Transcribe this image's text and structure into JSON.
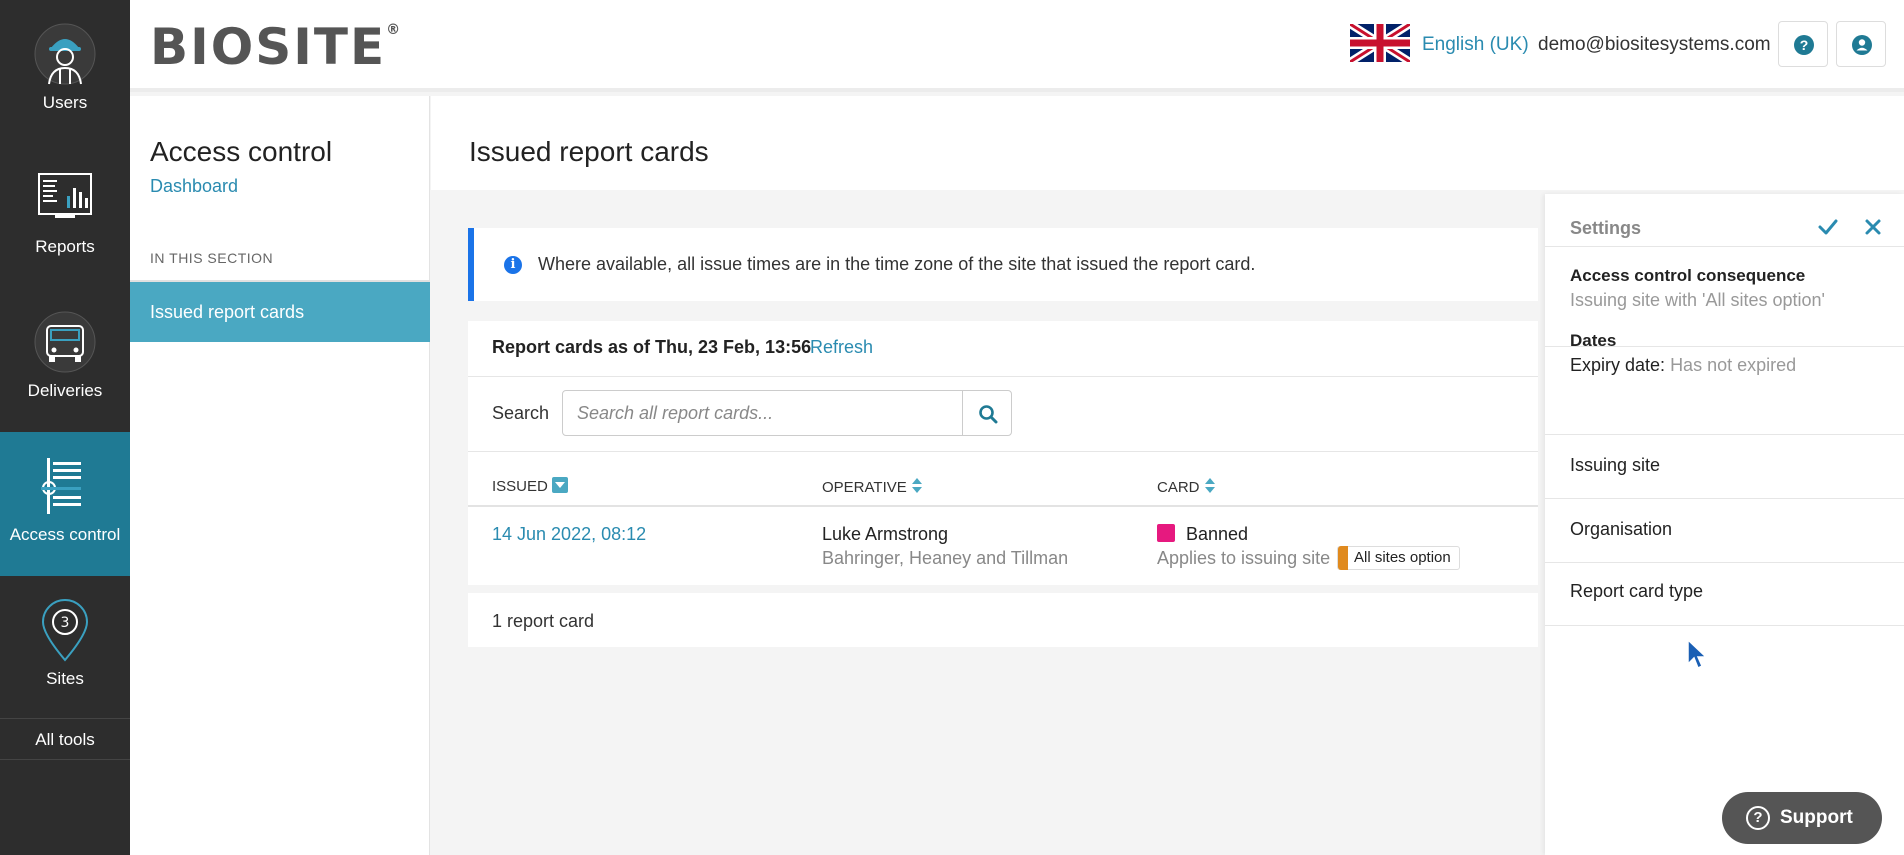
{
  "leftnav": {
    "items": [
      {
        "label": "Users",
        "icon": "worker-icon"
      },
      {
        "label": "Reports",
        "icon": "report-chart-icon"
      },
      {
        "label": "Deliveries",
        "icon": "truck-icon"
      },
      {
        "label": "Access control",
        "icon": "barrier-list-icon",
        "active": true
      },
      {
        "label": "Sites",
        "icon": "location-pin-icon"
      }
    ],
    "all_tools": "All tools"
  },
  "header": {
    "logo": "BIOSITE",
    "logo_mark": "®",
    "language": "English (UK)",
    "email": "demo@biositesystems.com",
    "help_icon": "help-icon",
    "user_icon": "user-icon",
    "help_glyph": "?",
    "user_glyph": "●"
  },
  "section": {
    "title": "Access control",
    "link": "Dashboard",
    "subheading": "IN THIS SECTION",
    "active_item": "Issued report cards"
  },
  "main": {
    "title": "Issued report cards",
    "info_glyph": "i",
    "info_text": "Where available, all issue times are in the time zone of the site that issued the report card.",
    "as_of": "Report cards as of Thu, 23 Feb, 13:56",
    "refresh": "Refresh",
    "search_label": "Search",
    "search_placeholder": "Search all report cards...",
    "columns": {
      "issued": "ISSUED",
      "operative": "OPERATIVE",
      "card": "CARD"
    },
    "rows": [
      {
        "issued": "14 Jun 2022, 08:12",
        "operative_name": "Luke Armstrong",
        "operative_org": "Bahringer, Heaney and Tillman",
        "card_name": "Banned",
        "card_color": "#e6197f",
        "card_scope": "Applies to issuing site",
        "badge": "All sites option"
      }
    ],
    "count": "1 report card"
  },
  "settings": {
    "title": "Settings",
    "consequence_title": "Access control consequence",
    "consequence_value": "Issuing site with 'All sites option'",
    "dates_title": "Dates",
    "expiry_label": "Expiry date:",
    "expiry_value": "Has not expired",
    "issuing_site": "Issuing site",
    "organisation": "Organisation",
    "report_card_type": "Report card type"
  },
  "support": {
    "label": "Support",
    "glyph": "?"
  },
  "colors": {
    "accent": "#1f7a94",
    "link": "#2a8bb0",
    "info": "#1a73e8",
    "banned": "#e6197f",
    "badge": "#e08a1e"
  }
}
